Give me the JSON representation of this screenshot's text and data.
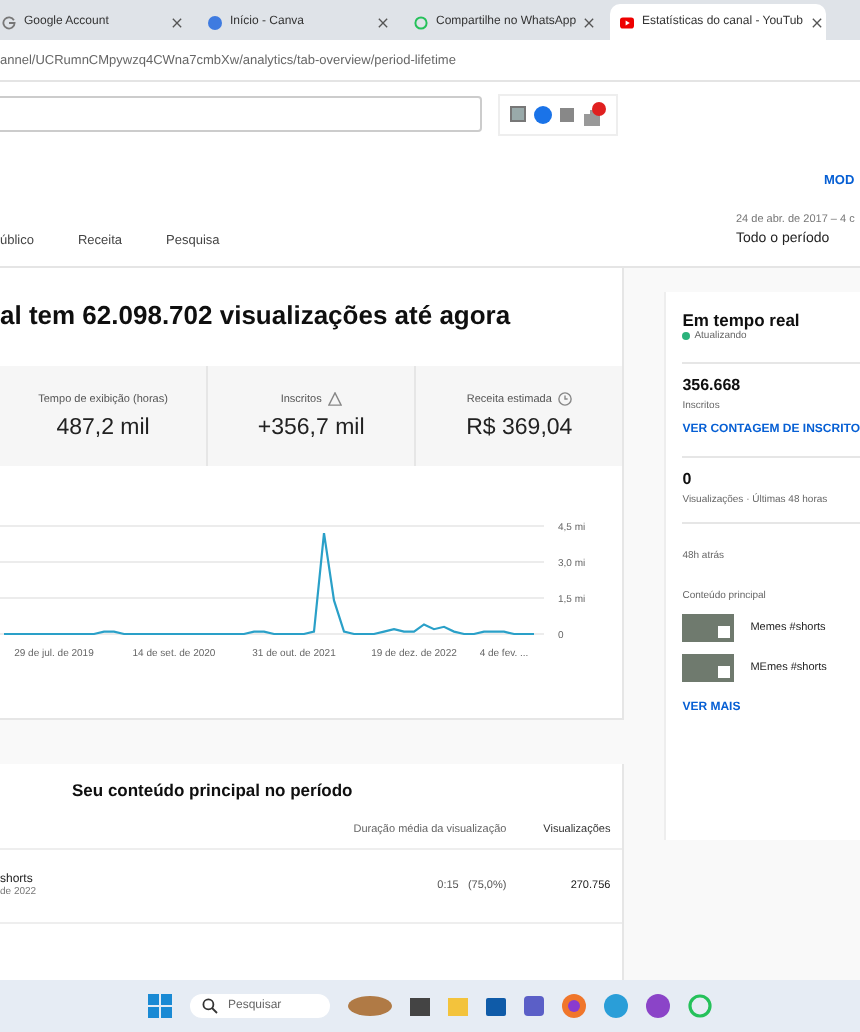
{
  "browser_tabs": [
    {
      "title": "Google Account",
      "selected": false
    },
    {
      "title": "Início - Canva",
      "selected": false
    },
    {
      "title": "Compartilhe no WhatsApp",
      "selected": false
    },
    {
      "title": "Estatísticas do canal - YouTub",
      "selected": true
    }
  ],
  "address_bar": {
    "url": "annel/UCRumnCMpywzq4CWna7cmbXw/analytics/tab-overview/period-lifetime"
  },
  "top_link": "MOD",
  "period": {
    "range": "24 de abr. de 2017 – 4 c",
    "label": "Todo o período"
  },
  "analytics_tabs": [
    {
      "label": "úblico",
      "selected": false
    },
    {
      "label": "Receita",
      "selected": false
    },
    {
      "label": "Pesquisa",
      "selected": false
    }
  ],
  "headline": "al tem 62.098.702 visualizações até agora",
  "metrics": [
    {
      "label": "Tempo de exibição (horas)",
      "value": "487,2 mil"
    },
    {
      "label": "Inscritos",
      "value": "+356,7 mil"
    },
    {
      "label": "Receita estimada",
      "value": "R$ 369,04"
    }
  ],
  "chart": {
    "chart_data": {
      "type": "line",
      "categories": [
        null,
        null,
        null,
        null,
        null,
        "29 de jul. de 2019",
        null,
        null,
        null,
        null,
        null,
        null,
        null,
        null,
        null,
        null,
        null,
        "14 de set. de 2020",
        null,
        null,
        null,
        null,
        null,
        null,
        null,
        null,
        null,
        null,
        null,
        "31 de out. de 2021",
        null,
        null,
        null,
        null,
        null,
        null,
        null,
        null,
        null,
        null,
        null,
        "19 de dez. de 2022",
        null,
        null,
        null,
        null,
        null,
        null,
        null,
        null,
        "4 de fev. ...",
        null,
        null,
        null
      ],
      "series": [
        {
          "color": "#2aa0c8",
          "values": [
            0,
            0,
            0,
            0,
            0,
            0,
            0,
            0,
            0,
            0,
            0.1,
            0.1,
            0,
            0,
            0,
            0,
            0,
            0,
            0,
            0,
            0,
            0,
            0,
            0,
            0,
            0.1,
            0.1,
            0,
            0,
            0,
            0,
            0.1,
            4.2,
            1.4,
            0.1,
            0,
            0,
            0,
            0.1,
            0.2,
            0.1,
            0.1,
            0.4,
            0.2,
            0.3,
            0.1,
            0,
            0,
            0.1,
            0.1,
            0.1,
            0,
            0,
            0
          ]
        }
      ],
      "ylim": [
        0,
        4.5
      ],
      "yticks": [
        {
          "value": 0,
          "label": "0"
        },
        {
          "value": 1.5,
          "label": "1,5 mi"
        },
        {
          "value": 3,
          "label": "3,0 mi"
        },
        {
          "value": 4.5,
          "label": "4,5 mi"
        }
      ]
    }
  },
  "top_content": {
    "title": "Seu conteúdo principal no período",
    "columns": [
      "Duração média da visualização",
      "Visualizações"
    ],
    "rows": [
      {
        "title": "shorts",
        "date": "de 2022",
        "duration": "0:15",
        "percent": "(75,0%)",
        "views": "270.756"
      }
    ]
  },
  "realtime": {
    "title": "Em tempo real",
    "status": "Atualizando",
    "subscribers": "356.668",
    "subscribers_label": "Inscritos",
    "subscribers_link": "VER CONTAGEM DE INSCRITO",
    "views": "0",
    "views_label": "Visualizações · Últimas 48 horas",
    "time_label": "48h atrás",
    "content_label": "Conteúdo principal",
    "items": [
      {
        "title": "Memes #shorts"
      },
      {
        "title": "MEmes #shorts"
      }
    ],
    "more_link": "VER MAIS"
  },
  "taskbar": {
    "search_placeholder": "Pesquisar"
  }
}
